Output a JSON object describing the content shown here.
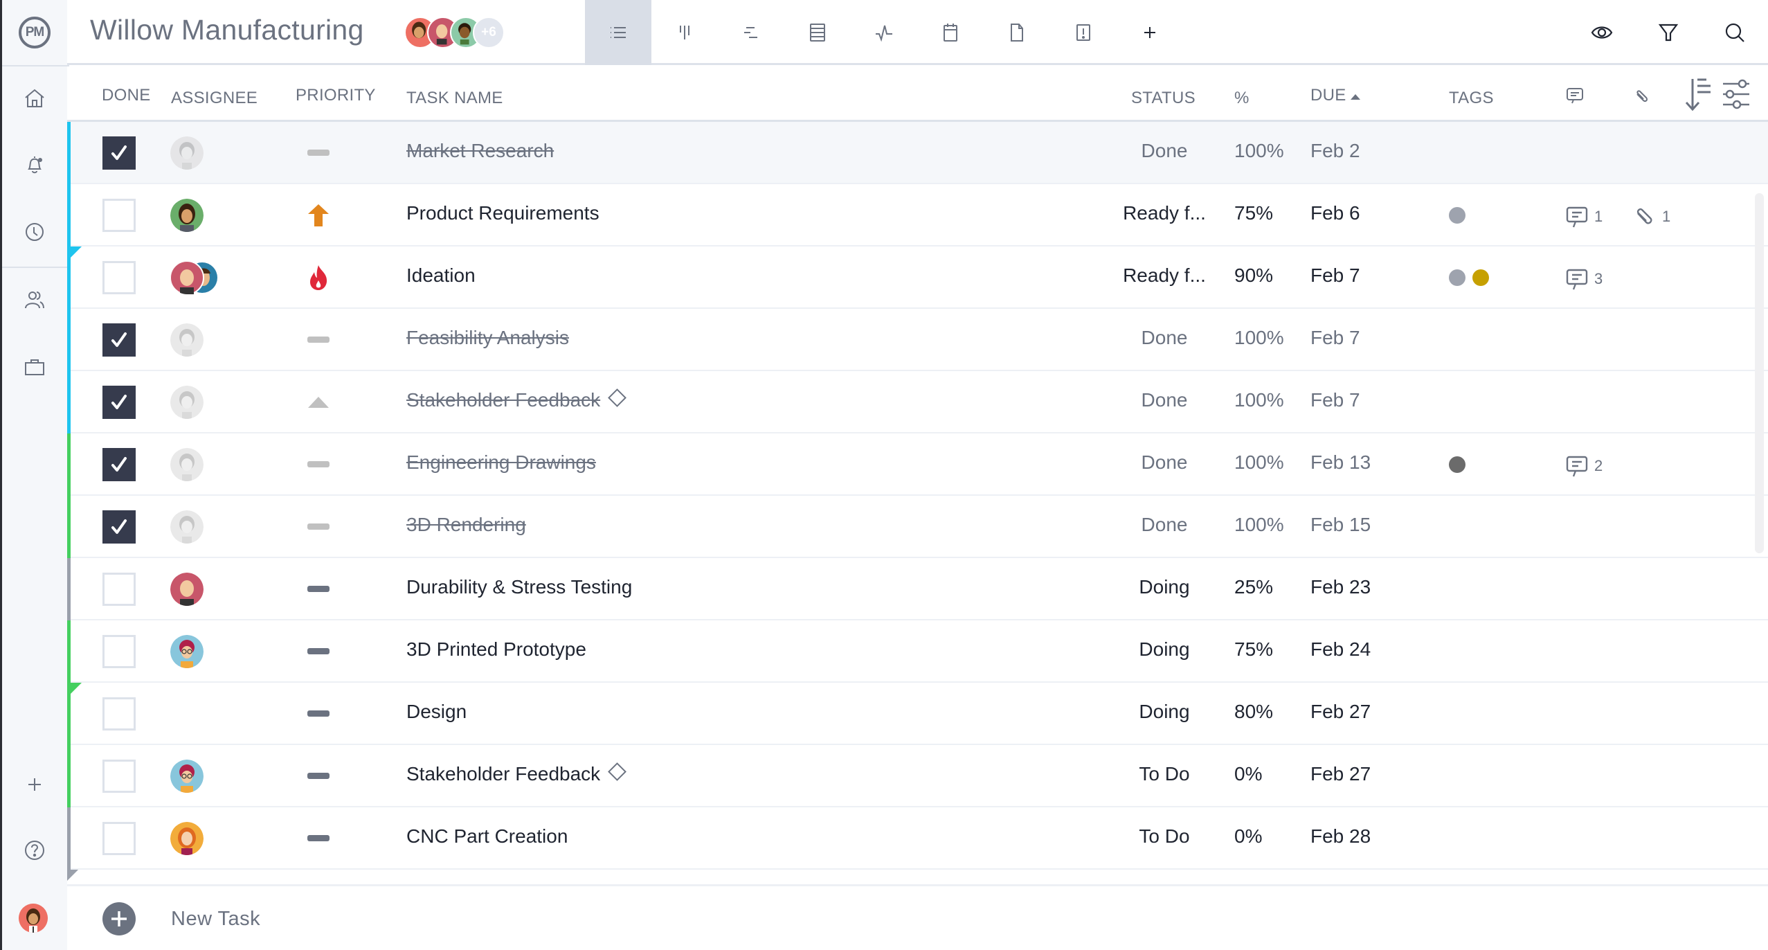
{
  "app": {
    "logo_text": "PM",
    "project_title": "Willow Manufacturing",
    "team_more_count": "+6"
  },
  "sidebar": {
    "items": [
      {
        "id": "home",
        "icon": "home-icon"
      },
      {
        "id": "notifications",
        "icon": "bell-icon"
      },
      {
        "id": "timesheets",
        "icon": "clock-icon"
      },
      {
        "id": "team",
        "icon": "people-icon"
      },
      {
        "id": "projects",
        "icon": "briefcase-icon"
      },
      {
        "id": "add",
        "icon": "plus-icon"
      },
      {
        "id": "help",
        "icon": "help-icon"
      }
    ]
  },
  "view_tabs": [
    {
      "id": "list",
      "icon": "list-view-icon",
      "active": true
    },
    {
      "id": "board",
      "icon": "board-view-icon",
      "active": false
    },
    {
      "id": "gantt",
      "icon": "gantt-view-icon",
      "active": false
    },
    {
      "id": "sheet",
      "icon": "sheet-view-icon",
      "active": false
    },
    {
      "id": "dashboard",
      "icon": "dashboard-icon",
      "active": false
    },
    {
      "id": "calendar",
      "icon": "calendar-icon",
      "active": false
    },
    {
      "id": "files",
      "icon": "file-icon",
      "active": false
    },
    {
      "id": "risks",
      "icon": "risk-icon",
      "active": false
    },
    {
      "id": "add-view",
      "icon": "plus-icon",
      "active": false
    }
  ],
  "header_actions": [
    {
      "id": "view",
      "icon": "eye-icon"
    },
    {
      "id": "filter",
      "icon": "filter-icon"
    },
    {
      "id": "search",
      "icon": "search-icon"
    }
  ],
  "columns": {
    "done": "DONE",
    "assignee": "ASSIGNEE",
    "priority": "PRIORITY",
    "task_name": "TASK NAME",
    "status": "STATUS",
    "percent": "%",
    "due": "DUE",
    "due_sort": "ascending",
    "tags": "TAGS"
  },
  "colors": {
    "bar_blue": "#1ec4ee",
    "bar_green": "#44cf5f",
    "bar_gray": "#9aa0ab",
    "check_dark": "#363b4d",
    "tag_gray": "#9ea3ae",
    "tag_gold": "#c6a000",
    "tag_dark": "#6b6b6b",
    "priority_high": "#e2861e",
    "priority_critical": "#e0283a",
    "priority_medium": "#6b7280",
    "priority_muted": "#c0c0c0"
  },
  "tasks": [
    {
      "name": "Market Research",
      "done": true,
      "assignee": "faded-woman-glasses",
      "priority": "medium",
      "status": "Done",
      "percent": "100%",
      "due": "Feb 2",
      "milestone": false,
      "bar": "blue",
      "corner": false,
      "tags": [],
      "comments": null,
      "attachments": null,
      "highlight": true
    },
    {
      "name": "Product Requirements",
      "done": false,
      "assignee": "woman-green",
      "priority": "high",
      "status": "Ready f...",
      "percent": "75%",
      "due": "Feb 6",
      "milestone": false,
      "bar": "blue",
      "corner": false,
      "tags": [
        "gray"
      ],
      "comments": "1",
      "attachments": "1",
      "highlight": false
    },
    {
      "name": "Ideation",
      "done": false,
      "assignee": "pair",
      "priority": "critical",
      "status": "Ready f...",
      "percent": "90%",
      "due": "Feb 7",
      "milestone": false,
      "bar": "blue",
      "corner": true,
      "tags": [
        "gray",
        "gold"
      ],
      "comments": "3",
      "attachments": null,
      "highlight": false
    },
    {
      "name": "Feasibility Analysis",
      "done": true,
      "assignee": "faded-man-glasses",
      "priority": "medium",
      "status": "Done",
      "percent": "100%",
      "due": "Feb 7",
      "milestone": false,
      "bar": "blue",
      "corner": false,
      "tags": [],
      "comments": null,
      "attachments": null,
      "highlight": false
    },
    {
      "name": "Stakeholder Feedback",
      "done": true,
      "assignee": "faded-woman",
      "priority": "low",
      "status": "Done",
      "percent": "100%",
      "due": "Feb 7",
      "milestone": true,
      "bar": "blue",
      "corner": false,
      "tags": [],
      "comments": null,
      "attachments": null,
      "highlight": false
    },
    {
      "name": "Engineering Drawings",
      "done": true,
      "assignee": "faded-woman-curly",
      "priority": "medium",
      "status": "Done",
      "percent": "100%",
      "due": "Feb 13",
      "milestone": false,
      "bar": "green",
      "corner": false,
      "tags": [
        "dark"
      ],
      "comments": "2",
      "attachments": null,
      "highlight": false
    },
    {
      "name": "3D Rendering",
      "done": true,
      "assignee": "faded-woman-long",
      "priority": "medium",
      "status": "Done",
      "percent": "100%",
      "due": "Feb 15",
      "milestone": false,
      "bar": "green",
      "corner": false,
      "tags": [],
      "comments": null,
      "attachments": null,
      "highlight": false
    },
    {
      "name": "Durability & Stress Testing",
      "done": false,
      "assignee": "bald-man",
      "priority": "medium",
      "status": "Doing",
      "percent": "25%",
      "due": "Feb 23",
      "milestone": false,
      "bar": "gray",
      "corner": false,
      "tags": [],
      "comments": null,
      "attachments": null,
      "highlight": false
    },
    {
      "name": "3D Printed Prototype",
      "done": false,
      "assignee": "woman-glasses-blue",
      "priority": "medium",
      "status": "Doing",
      "percent": "75%",
      "due": "Feb 24",
      "milestone": false,
      "bar": "green",
      "corner": false,
      "tags": [],
      "comments": null,
      "attachments": null,
      "highlight": false
    },
    {
      "name": "Design",
      "done": false,
      "assignee": null,
      "priority": "medium",
      "status": "Doing",
      "percent": "80%",
      "due": "Feb 27",
      "milestone": false,
      "bar": "green",
      "corner": true,
      "tags": [],
      "comments": null,
      "attachments": null,
      "highlight": false
    },
    {
      "name": "Stakeholder Feedback",
      "done": false,
      "assignee": "woman-glasses-blue",
      "priority": "medium",
      "status": "To Do",
      "percent": "0%",
      "due": "Feb 27",
      "milestone": true,
      "bar": "green",
      "corner": false,
      "tags": [],
      "comments": null,
      "attachments": null,
      "highlight": false
    },
    {
      "name": "CNC Part Creation",
      "done": false,
      "assignee": "woman-orange",
      "priority": "medium",
      "status": "To Do",
      "percent": "0%",
      "due": "Feb 28",
      "milestone": false,
      "bar": "gray",
      "corner": false,
      "tags": [],
      "comments": null,
      "attachments": null,
      "highlight": false
    }
  ],
  "new_task": {
    "label": "New Task"
  }
}
